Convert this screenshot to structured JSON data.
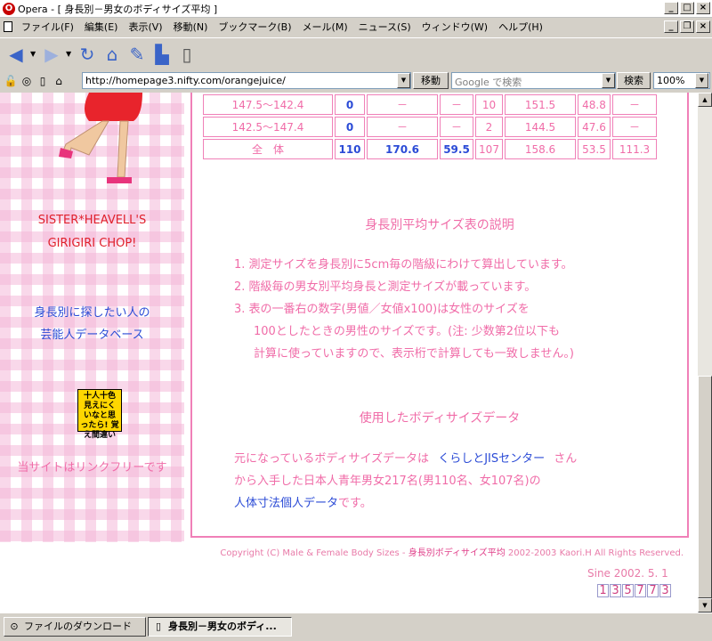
{
  "window": {
    "title": "Opera - [ 身長別－男女のボディサイズ平均 ]",
    "app_icon": "O"
  },
  "menu": [
    "ファイル(F)",
    "編集(E)",
    "表示(V)",
    "移動(N)",
    "ブックマーク(B)",
    "メール(M)",
    "ニュース(S)",
    "ウィンドウ(W)",
    "ヘルプ(H)"
  ],
  "address": {
    "url": "http://homepage3.nifty.com/orangejuice/",
    "go_label": "移動",
    "search_placeholder": "Google で検索",
    "search_button": "検索",
    "zoom": "100%"
  },
  "sidebar": {
    "title_line1": "SISTER*HEAVELL'S",
    "title_line2": "GIRIGIRI CHOP!",
    "link_line1": "身長別に探したい人の",
    "link_line2": "芸能人データベース",
    "logo_text": "十人十色 見えにくいなと思ったら! 覚え間違い",
    "free_link": "当サイトはリンクフリーです"
  },
  "table": {
    "rows": [
      [
        "147.5～142.4",
        "0",
        "－",
        "－",
        "10",
        "151.5",
        "48.8",
        "－"
      ],
      [
        "142.5～147.4",
        "0",
        "－",
        "－",
        "2",
        "144.5",
        "47.6",
        "－"
      ],
      [
        "全　体",
        "110",
        "170.6",
        "59.5",
        "107",
        "158.6",
        "53.5",
        "111.3"
      ]
    ]
  },
  "explanation": {
    "title": "身長別平均サイズ表の説明",
    "items": [
      "1. 測定サイズを身長別に5cm毎の階級にわけて算出しています。",
      "2. 階級毎の男女別平均身長と測定サイズが載っています。",
      "3. 表の一番右の数字(男値／女値x100)は女性のサイズを",
      "100としたときの男性のサイズです。(注: 少数第2位以下も",
      "計算に使っていますので、表示桁で計算しても一致しません。)"
    ]
  },
  "source": {
    "title": "使用したボディサイズデータ",
    "line1_pre": "元になっているボディサイズデータは",
    "line1_link": "くらしとJISセンター",
    "line1_post": "さん",
    "line2": "から入手した日本人青年男女217名(男110名、女107名)の",
    "line3_link": "人体寸法個人データ",
    "line3_post": "です。"
  },
  "footer": {
    "copyright_pre": "Copyright (C) Male & Female Body Sizes - ",
    "copyright_jp": "身長別ボディサイズ平均",
    "copyright_post": " 2002-2003 Kaori.H All Rights Reserved.",
    "since": "Sine 2002. 5. 1",
    "counter": [
      "1",
      "3",
      "5",
      "7",
      "7",
      "3"
    ]
  },
  "taskbar": {
    "downloads": "ファイルのダウンロード",
    "active_tab": "身長別－男女のボディ..."
  }
}
